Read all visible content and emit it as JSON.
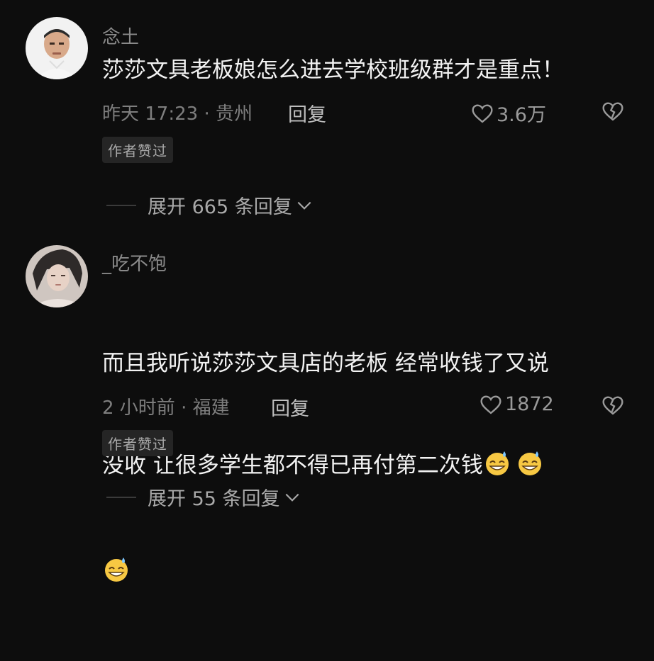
{
  "comments": [
    {
      "username": "念土",
      "content": "莎莎文具老板娘怎么进去学校班级群才是重点！",
      "meta": "昨天 17:23 · 贵州",
      "reply": "回复",
      "likes": "3.6万",
      "badge": "作者赞过",
      "expand": "展开 665 条回复"
    },
    {
      "username": "_吃不饱",
      "content_1": "而且我听说莎莎文具店的老板 经常收钱了又说",
      "content_2": "没收 让很多学生都不得已再付第二次钱",
      "meta": "2 小时前 · 福建",
      "reply": "回复",
      "likes": "1872",
      "badge": "作者赞过",
      "expand": "展开 55 条回复"
    }
  ],
  "icons": {
    "like": "heart-outline-icon",
    "dislike": "broken-heart-icon",
    "expand": "chevron-down-icon",
    "emoji": "grinning-sweat-emoji-icon"
  }
}
